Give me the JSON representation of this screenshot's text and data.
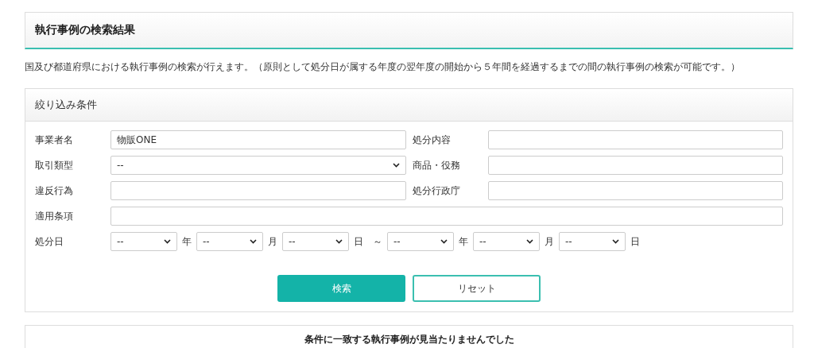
{
  "page_title": "執行事例の検索結果",
  "description": "国及び都道府県における執行事例の検索が行えます。（原則として処分日が属する年度の翌年度の開始から５年間を経過するまでの間の執行事例の検索が可能です。）",
  "filter": {
    "title": "絞り込み条件",
    "rows": [
      [
        {
          "label": "事業者名",
          "kind": "text",
          "value": "物販ONE"
        },
        {
          "label": "処分内容",
          "kind": "text"
        }
      ],
      [
        {
          "label": "取引類型",
          "kind": "select",
          "value": "--"
        },
        {
          "label": "商品・役務",
          "kind": "text"
        }
      ],
      [
        {
          "label": "違反行為",
          "kind": "text"
        },
        {
          "label": "処分行政庁",
          "kind": "text"
        }
      ],
      [
        {
          "label": "適用条項",
          "kind": "text"
        }
      ],
      [
        {
          "label": "処分日",
          "kind": "date",
          "parts": [
            {
              "kind": "select",
              "value": "--"
            },
            {
              "kind": "unit",
              "text": "年"
            },
            {
              "kind": "select",
              "value": "--"
            },
            {
              "kind": "unit",
              "text": "月"
            },
            {
              "kind": "select",
              "value": "--"
            },
            {
              "kind": "unit",
              "text": "日"
            },
            {
              "kind": "unit",
              "text": "～"
            },
            {
              "kind": "select",
              "value": "--"
            },
            {
              "kind": "unit",
              "text": "年"
            },
            {
              "kind": "select",
              "value": "--"
            },
            {
              "kind": "unit",
              "text": "月"
            },
            {
              "kind": "select",
              "value": "--"
            },
            {
              "kind": "unit",
              "text": "日"
            }
          ]
        }
      ]
    ],
    "buttons": [
      {
        "label": "検索",
        "kind": "primary"
      },
      {
        "label": "リセット",
        "kind": "secondary"
      }
    ]
  },
  "result_message": "条件に一致する執行事例が見当たりませんでした"
}
